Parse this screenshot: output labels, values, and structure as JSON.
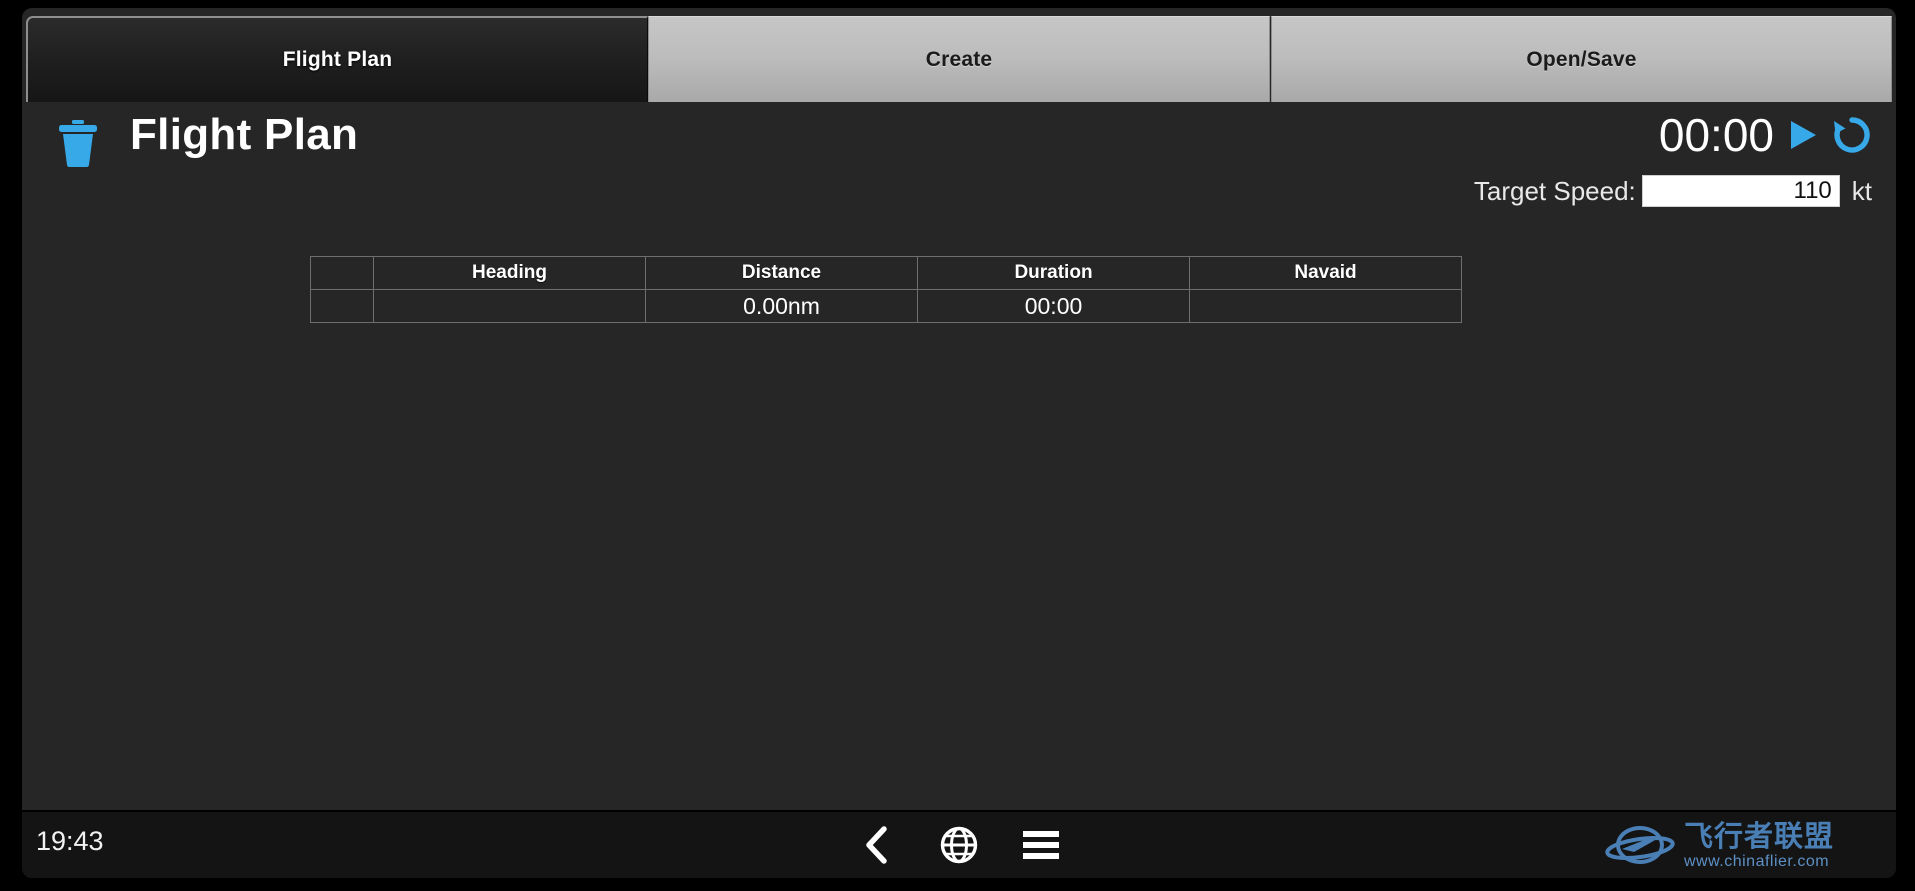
{
  "tabs": [
    {
      "label": "Flight Plan",
      "active": true
    },
    {
      "label": "Create",
      "active": false
    },
    {
      "label": "Open/Save",
      "active": false
    }
  ],
  "header": {
    "title": "Flight Plan",
    "delete_icon": "trash-icon",
    "timer_value": "00:00",
    "play_icon": "play-icon",
    "reset_icon": "reset-icon"
  },
  "target_speed": {
    "label": "Target Speed:",
    "value": "110",
    "placeholder": "",
    "unit": "kt"
  },
  "table": {
    "columns": [
      "",
      "Heading",
      "Distance",
      "Duration",
      "Navaid"
    ],
    "rows": [
      {
        "index": "",
        "heading": "",
        "distance": "0.00nm",
        "duration": "00:00",
        "navaid": ""
      }
    ]
  },
  "bottom_bar": {
    "clock": "19:43",
    "nav_icons": [
      "back-chevron-icon",
      "globe-icon",
      "hamburger-menu-icon"
    ]
  },
  "watermark": {
    "logo_icon": "saturn-plane-logo-icon",
    "name_cn": "飞行者联盟",
    "url": "www.chinaflier.com"
  },
  "colors": {
    "accent_blue": "#37a8e8",
    "panel_bg": "#262626",
    "tab_inactive": "#bdbdbd",
    "bottom_bar_bg": "#141414",
    "watermark_blue": "#4a7fb5"
  }
}
